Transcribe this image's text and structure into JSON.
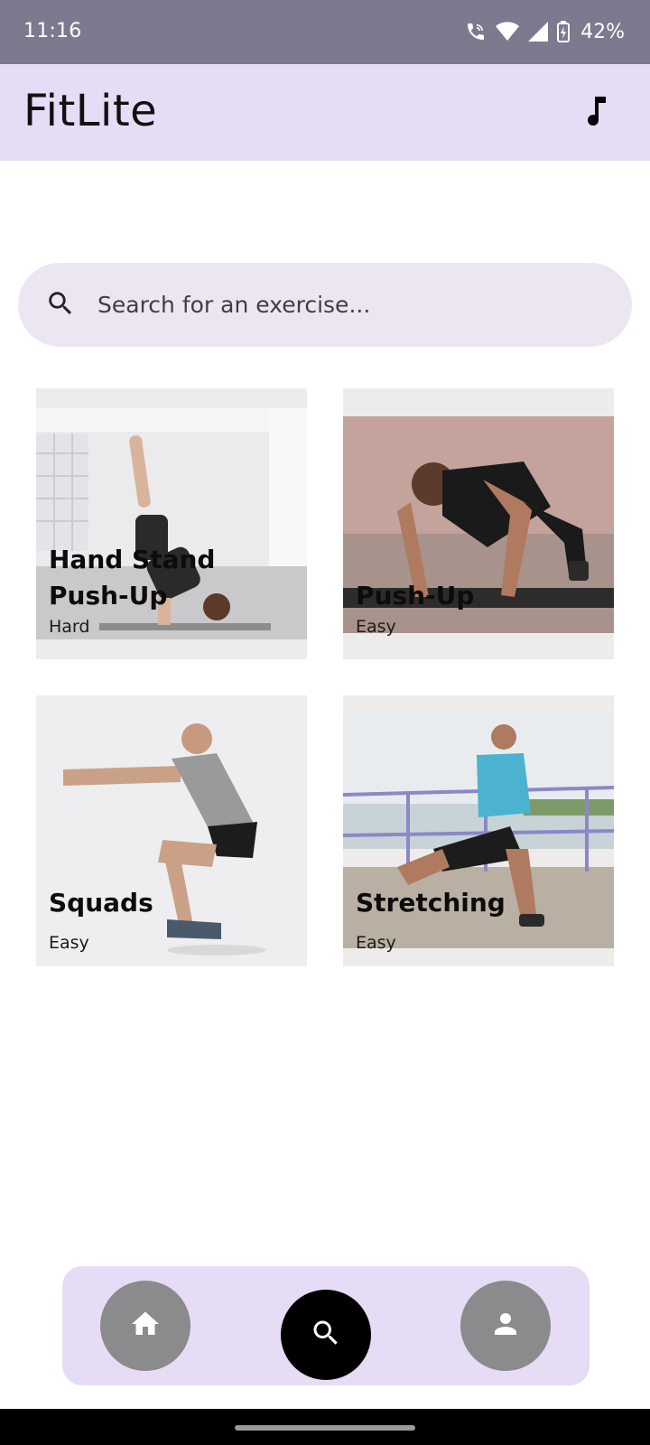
{
  "status_bar": {
    "time": "11:16",
    "battery": "42%",
    "icons": [
      "wifi-calling-icon",
      "wifi-icon",
      "cellular-signal-icon",
      "battery-charging-icon"
    ]
  },
  "app_bar": {
    "title": "FitLite",
    "action_icon": "music-note-icon"
  },
  "search": {
    "placeholder": "Search for an exercise...",
    "value": ""
  },
  "exercises": [
    {
      "title": "Hand Stand Push-Up",
      "level": "Hard"
    },
    {
      "title": "Push-Up",
      "level": "Easy"
    },
    {
      "title": "Squads",
      "level": "Easy"
    },
    {
      "title": "Stretching",
      "level": "Easy"
    }
  ],
  "bottom_nav": {
    "items": [
      {
        "icon": "home-icon",
        "active": false
      },
      {
        "icon": "search-icon",
        "active": true
      },
      {
        "icon": "person-icon",
        "active": false
      }
    ]
  },
  "colors": {
    "status_bar": "#7b7a8e",
    "app_bar": "#e6dcf5",
    "search_bg": "#ece6f3",
    "nav_active": "#000000",
    "nav_inactive": "#8b8a8c"
  }
}
